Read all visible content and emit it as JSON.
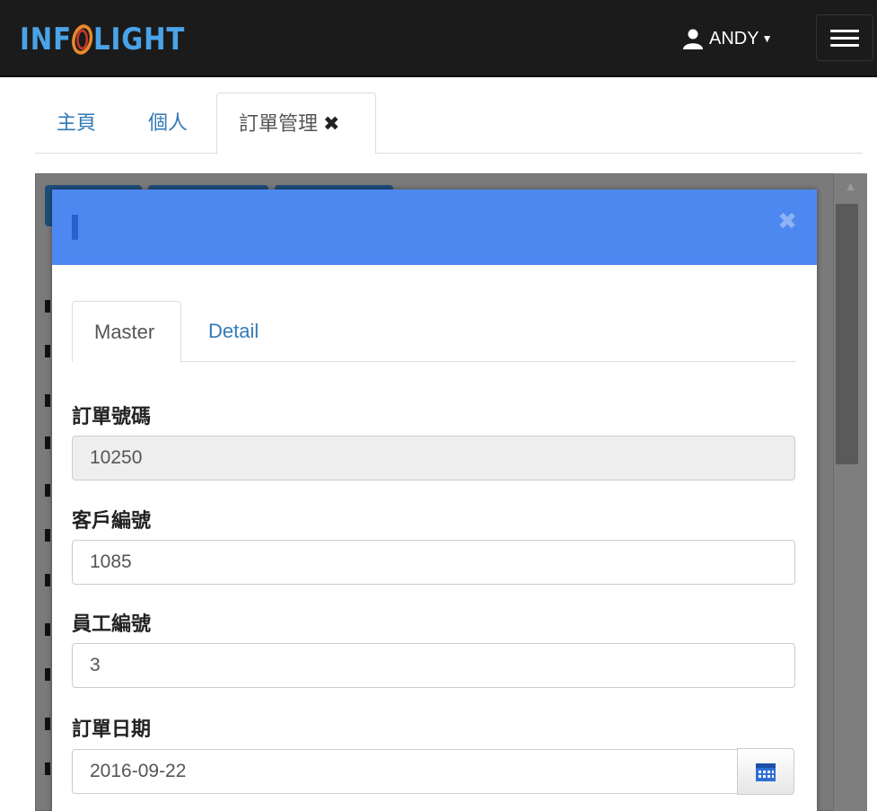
{
  "navbar": {
    "brand": "INFOLIGHT",
    "user": "ANDY",
    "menu_icon": "hamburger-icon"
  },
  "page_tabs": [
    {
      "label": "主頁"
    },
    {
      "label": "個人"
    },
    {
      "label": "訂單管理",
      "close_icon": "close-icon"
    }
  ],
  "modal": {
    "tabs": [
      {
        "label": "Master"
      },
      {
        "label": "Detail"
      }
    ],
    "fields": [
      {
        "label": "訂單號碼",
        "value": "10250"
      },
      {
        "label": "客戶編號",
        "value": "1085"
      },
      {
        "label": "員工編號",
        "value": "3"
      },
      {
        "label": "訂單日期",
        "value": "2016-09-22"
      }
    ]
  },
  "colors": {
    "navbar_bg": "#1b1b1b",
    "brand": "#4aa3e8",
    "modal_header": "#4d88f1",
    "link": "#337ab7"
  }
}
